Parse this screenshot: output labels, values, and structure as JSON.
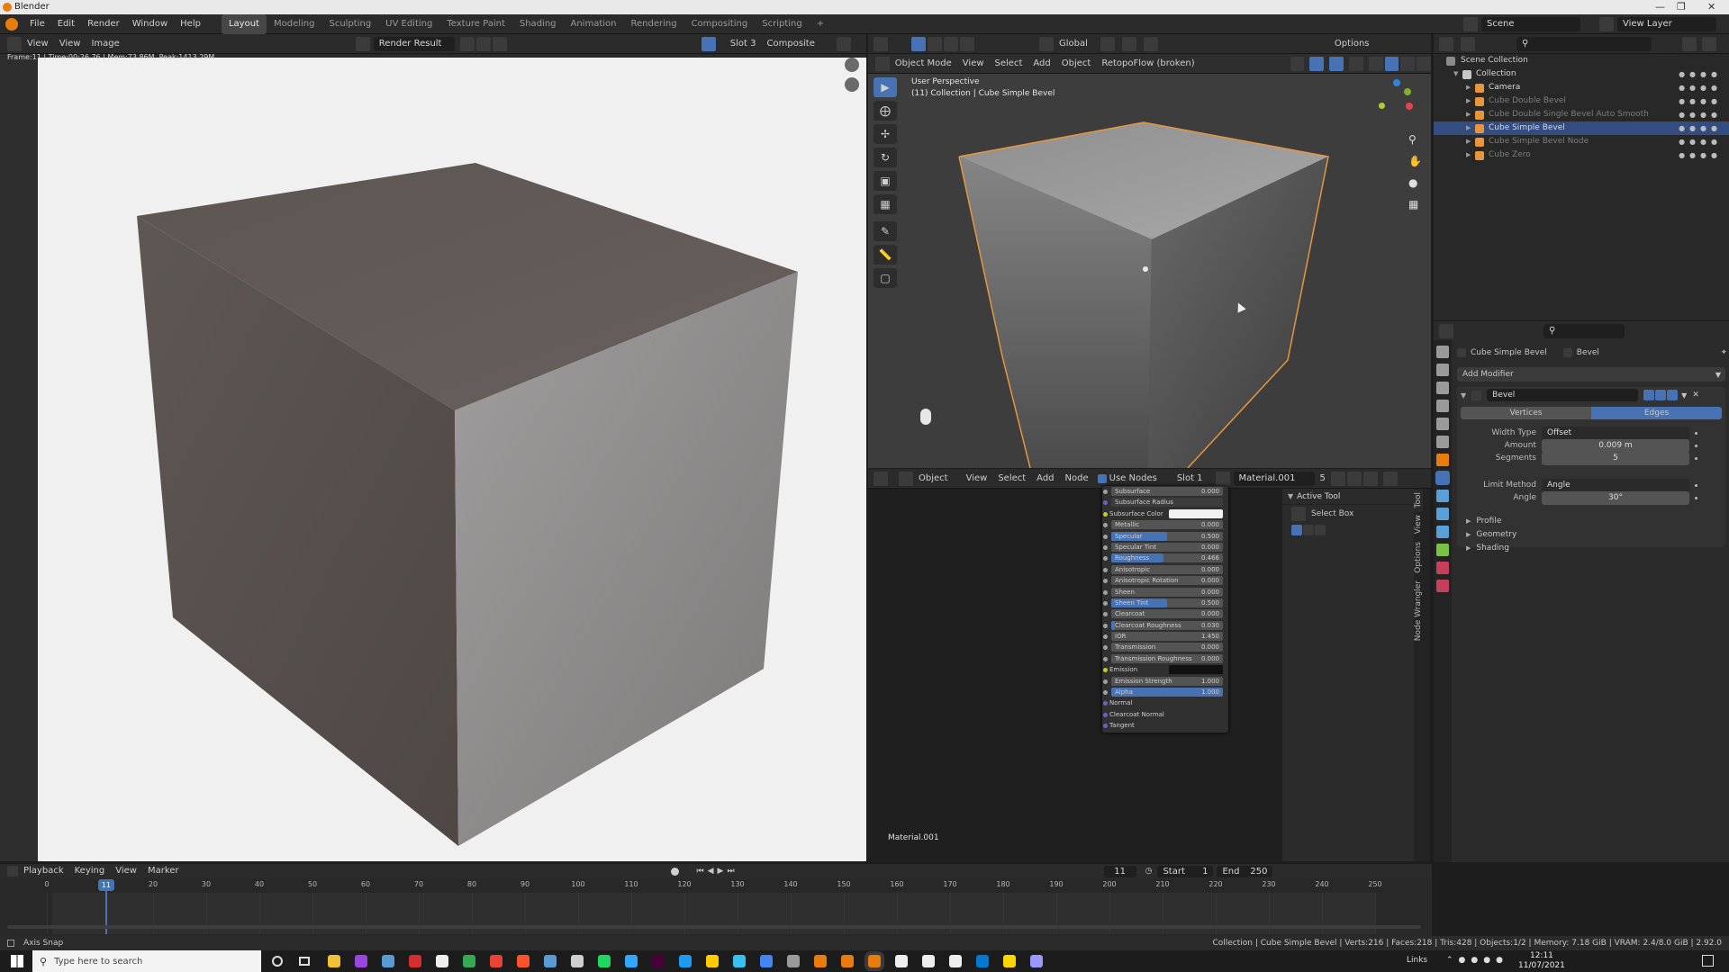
{
  "window": {
    "title": "Blender"
  },
  "menu": [
    "File",
    "Edit",
    "Render",
    "Window",
    "Help"
  ],
  "workspaces": [
    "Layout",
    "Modeling",
    "Sculpting",
    "UV Editing",
    "Texture Paint",
    "Shading",
    "Animation",
    "Rendering",
    "Compositing",
    "Scripting"
  ],
  "workspace_active": "Layout",
  "scene": {
    "label": "Scene",
    "view_layer": "View Layer"
  },
  "image_editor": {
    "header": {
      "view": "View",
      "view2": "View",
      "image": "Image",
      "image_name": "Render Result",
      "slot": "Slot 3",
      "composite": "Composite"
    },
    "frame_info": "Frame:11 | Time:00:26.76 | Mem:73.86M, Peak:1413.29M"
  },
  "viewport": {
    "header": {
      "mode": "Object Mode",
      "view": "View",
      "select": "Select",
      "add": "Add",
      "object": "Object",
      "addon": "RetopoFlow (broken)",
      "transform": "Global",
      "options": "Options"
    },
    "overlay_line1": "User Perspective",
    "overlay_line2": "(11) Collection | Cube Simple Bevel"
  },
  "node_editor": {
    "header": {
      "object": "Object",
      "view": "View",
      "select": "Select",
      "add": "Add",
      "node": "Node",
      "use_nodes": "Use Nodes",
      "slot": "Slot 1",
      "material": "Material.001",
      "users": "5"
    },
    "material_label": "Material.001",
    "rows": [
      {
        "label": "Subsurface",
        "value": "0.000",
        "kind": "slider",
        "socket": "g",
        "fill": 0
      },
      {
        "label": "Subsurface Radius",
        "value": "",
        "kind": "dropdown",
        "socket": "p"
      },
      {
        "label": "Subsurface Color",
        "value": "",
        "kind": "color",
        "socket": "y",
        "color": "#f2f2f2"
      },
      {
        "label": "Metallic",
        "value": "0.000",
        "kind": "slider",
        "socket": "g",
        "fill": 0
      },
      {
        "label": "Specular",
        "value": "0.500",
        "kind": "slider",
        "socket": "g",
        "fill": 0.5
      },
      {
        "label": "Specular Tint",
        "value": "0.000",
        "kind": "slider",
        "socket": "g",
        "fill": 0
      },
      {
        "label": "Roughness",
        "value": "0.466",
        "kind": "slider",
        "socket": "g",
        "fill": 0.466
      },
      {
        "label": "Anisotropic",
        "value": "0.000",
        "kind": "slider",
        "socket": "g",
        "fill": 0
      },
      {
        "label": "Anisotropic Rotation",
        "value": "0.000",
        "kind": "slider",
        "socket": "g",
        "fill": 0
      },
      {
        "label": "Sheen",
        "value": "0.000",
        "kind": "slider",
        "socket": "g",
        "fill": 0
      },
      {
        "label": "Sheen Tint",
        "value": "0.500",
        "kind": "slider",
        "socket": "g",
        "fill": 0.5
      },
      {
        "label": "Clearcoat",
        "value": "0.000",
        "kind": "slider",
        "socket": "g",
        "fill": 0
      },
      {
        "label": "Clearcoat Roughness",
        "value": "0.030",
        "kind": "slider",
        "socket": "g",
        "fill": 0.03
      },
      {
        "label": "IOR",
        "value": "1.450",
        "kind": "slider",
        "socket": "g",
        "fill": 0
      },
      {
        "label": "Transmission",
        "value": "0.000",
        "kind": "slider",
        "socket": "g",
        "fill": 0
      },
      {
        "label": "Transmission Roughness",
        "value": "0.000",
        "kind": "slider",
        "socket": "g",
        "fill": 0
      },
      {
        "label": "Emission",
        "value": "",
        "kind": "color",
        "socket": "y",
        "color": "#111111"
      },
      {
        "label": "Emission Strength",
        "value": "1.000",
        "kind": "slider",
        "socket": "g",
        "fill": 0
      },
      {
        "label": "Alpha",
        "value": "1.000",
        "kind": "slider",
        "socket": "g",
        "fill": 1
      },
      {
        "label": "Normal",
        "value": "",
        "kind": "plain",
        "socket": "p"
      },
      {
        "label": "Clearcoat Normal",
        "value": "",
        "kind": "plain",
        "socket": "p"
      },
      {
        "label": "Tangent",
        "value": "",
        "kind": "plain",
        "socket": "p"
      }
    ]
  },
  "npanel": {
    "section": "Active Tool",
    "tool": "Select Box",
    "tabs": [
      "Tool",
      "View",
      "Options",
      "Node Wrangler"
    ]
  },
  "outliner": {
    "root": "Scene Collection",
    "items": [
      {
        "label": "Collection",
        "depth": 0,
        "selected": false,
        "dim": false
      },
      {
        "label": "Camera",
        "depth": 1,
        "selected": false,
        "dim": false
      },
      {
        "label": "Cube Double Bevel",
        "depth": 1,
        "selected": false,
        "dim": true
      },
      {
        "label": "Cube Double Single Bevel Auto Smooth",
        "depth": 1,
        "selected": false,
        "dim": true
      },
      {
        "label": "Cube Simple Bevel",
        "depth": 1,
        "selected": true,
        "dim": false
      },
      {
        "label": "Cube Simple Bevel Node",
        "depth": 1,
        "selected": false,
        "dim": true
      },
      {
        "label": "Cube Zero",
        "depth": 1,
        "selected": false,
        "dim": true
      }
    ]
  },
  "properties": {
    "object": "Cube Simple Bevel",
    "modifier_tab": "Bevel",
    "add_modifier": "Add Modifier",
    "modifier_name": "Bevel",
    "affect": [
      "Vertices",
      "Edges"
    ],
    "affect_active": "Edges",
    "fields": [
      {
        "label": "Width Type",
        "value": "Offset",
        "kind": "dropdown"
      },
      {
        "label": "Amount",
        "value": "0.009 m",
        "kind": "number"
      },
      {
        "label": "Segments",
        "value": "5",
        "kind": "number"
      },
      {
        "label": "Limit Method",
        "value": "Angle",
        "kind": "dropdown"
      },
      {
        "label": "Angle",
        "value": "30°",
        "kind": "number"
      }
    ],
    "panels": [
      "Profile",
      "Geometry",
      "Shading"
    ]
  },
  "timeline": {
    "header": {
      "playback": "Playback",
      "keying": "Keying",
      "view": "View",
      "marker": "Marker"
    },
    "current_frame": "11",
    "start_label": "Start",
    "start": "1",
    "end_label": "End",
    "end": "250",
    "ticks": [
      "0",
      "20",
      "30",
      "40",
      "50",
      "60",
      "70",
      "80",
      "90",
      "100",
      "110",
      "120",
      "130",
      "140",
      "150",
      "160",
      "170",
      "180",
      "190",
      "200",
      "210",
      "220",
      "230",
      "240",
      "250"
    ],
    "tick_frames": [
      0,
      20,
      30,
      40,
      50,
      60,
      70,
      80,
      90,
      100,
      110,
      120,
      130,
      140,
      150,
      160,
      170,
      180,
      190,
      200,
      210,
      220,
      230,
      240,
      250
    ]
  },
  "status": {
    "left": "Axis Snap",
    "right": "Collection | Cube Simple Bevel | Verts:216 | Faces:218 | Tris:428 | Objects:1/2 | Memory: 7.18 GiB | VRAM: 2.4/8.0 GiB | 2.92.0"
  },
  "taskbar": {
    "search_placeholder": "Type here to search",
    "links": "Links",
    "time": "12:11",
    "date": "11/07/2021"
  },
  "colors": {
    "accent": "#4772b3",
    "selection": "#e8963c",
    "selected_row": "#334d80"
  }
}
